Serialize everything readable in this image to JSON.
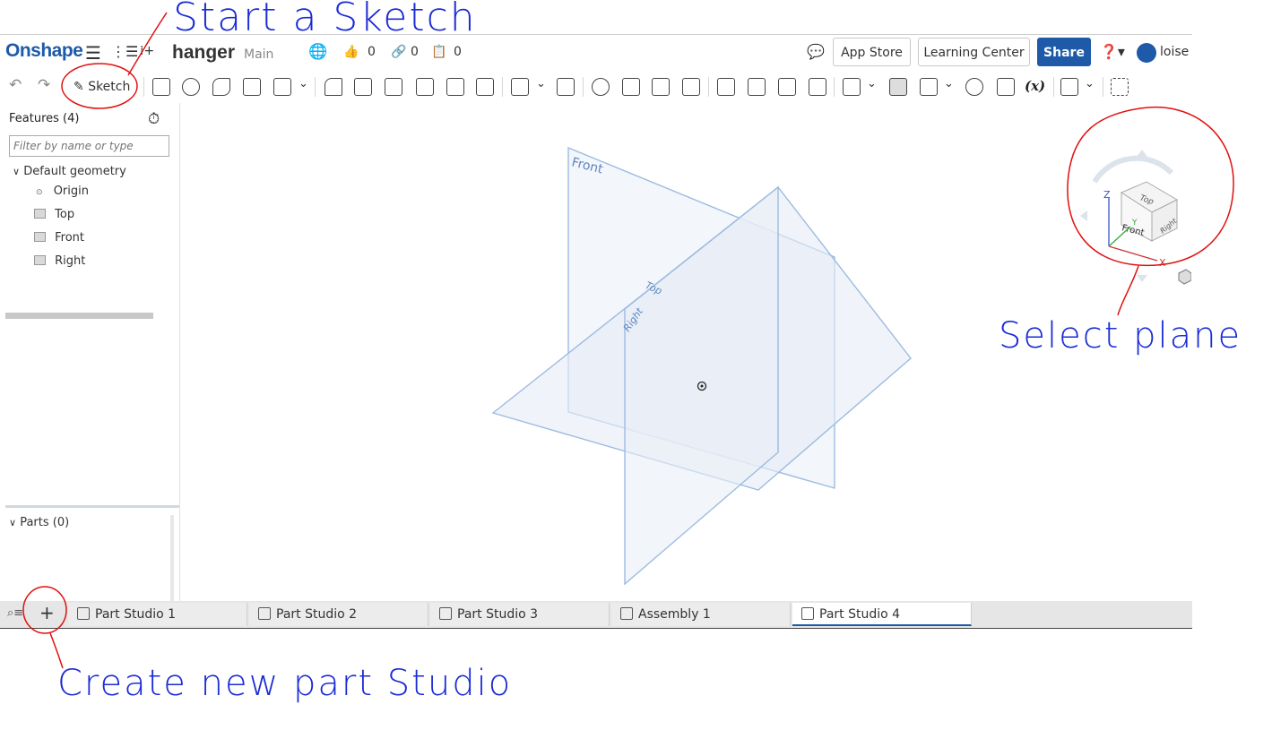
{
  "annotations": {
    "start_sketch": "Start a Sketch",
    "select_plane": "Select plane",
    "create_part_studio": "Create new part Studio"
  },
  "header": {
    "logo": "Onshape",
    "document_name": "hanger",
    "branch": "Main",
    "likes": "0",
    "links": "0",
    "copies": "0",
    "app_store": "App Store",
    "learning_center": "Learning Center",
    "share": "Share",
    "user": "loise l"
  },
  "toolbar": {
    "sketch_label": "Sketch",
    "variable_label": "(x)"
  },
  "features": {
    "title": "Features (4)",
    "filter_placeholder": "Filter by name or type",
    "group": "Default geometry",
    "items": [
      "Origin",
      "Top",
      "Front",
      "Right"
    ],
    "parts": "Parts (0)"
  },
  "viewport": {
    "plane_labels": {
      "front": "Front",
      "top": "Top",
      "right": "Right"
    },
    "view_cube": {
      "top": "Top",
      "front": "Front",
      "right": "Right",
      "x": "X",
      "y": "Y",
      "z": "Z"
    }
  },
  "tabs": [
    {
      "label": "Part Studio 1",
      "active": false
    },
    {
      "label": "Part Studio 2",
      "active": false
    },
    {
      "label": "Part Studio 3",
      "active": false
    },
    {
      "label": "Assembly 1",
      "active": false
    },
    {
      "label": "Part Studio 4",
      "active": true
    }
  ],
  "colors": {
    "brand": "#1e5aa8",
    "plane_stroke": "#9cbbe0",
    "annotation": "#1a2bd6",
    "circle": "#e01010"
  }
}
